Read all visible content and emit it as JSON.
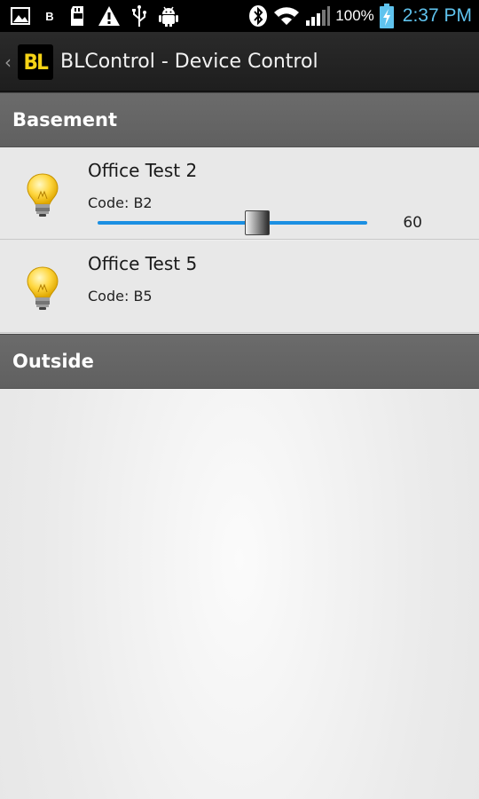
{
  "status_bar": {
    "left_icons": [
      "gallery-icon",
      "b-notification-icon",
      "sd-card-icon",
      "warning-icon",
      "usb-icon",
      "android-debug-icon"
    ],
    "b_label": "B",
    "right_icons": [
      "bluetooth-icon",
      "wifi-icon",
      "signal-icon",
      "battery-charging-icon"
    ],
    "battery_percent": "100%",
    "time": "2:37 PM",
    "time_color": "#5fc3ee"
  },
  "action_bar": {
    "logo_text": "BL",
    "logo_color": "#f5d316",
    "title": "BLControl - Device Control"
  },
  "sections": [
    {
      "name": "Basement",
      "devices": [
        {
          "name": "Office Test 2",
          "code": "Code: B2",
          "icon": "light-bulb-icon",
          "has_slider": true,
          "slider_value": "60",
          "slider_fraction": 0.6
        },
        {
          "name": "Office Test 5",
          "code": "Code: B5",
          "icon": "light-bulb-icon",
          "has_slider": false
        }
      ]
    },
    {
      "name": "Outside",
      "devices": []
    }
  ],
  "colors": {
    "accent": "#1b8fe2",
    "section_header": "#666666",
    "row_background": "#e8e8e8"
  }
}
